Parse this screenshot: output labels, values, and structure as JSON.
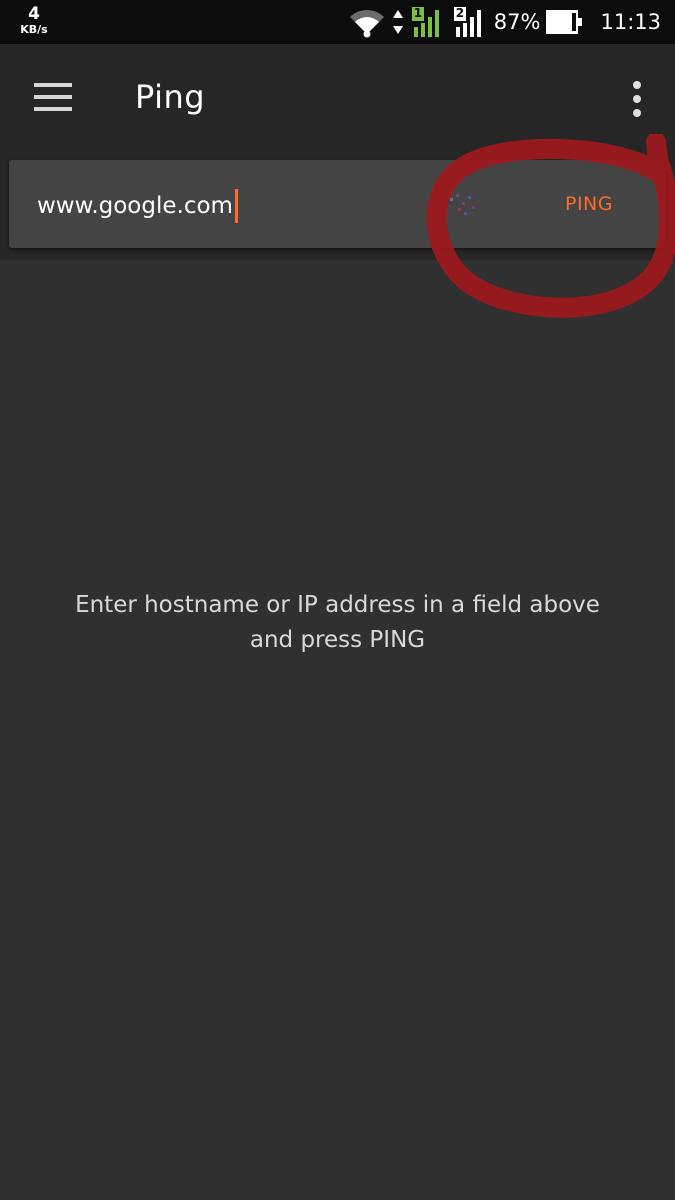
{
  "status_bar": {
    "net_speed_value": "4",
    "net_speed_unit": "KB/s",
    "sim1_label": "1",
    "sim2_label": "2",
    "battery_percent": "87%",
    "clock": "11:13",
    "icons": [
      "wifi-icon",
      "data-arrows-icon",
      "signal-sim1-icon",
      "signal-sim2-icon",
      "battery-icon"
    ]
  },
  "app_bar": {
    "title": "Ping",
    "icons": [
      "menu-icon",
      "overflow-menu-icon"
    ]
  },
  "ping_form": {
    "host_value": "www.google.com",
    "button_label": "PING"
  },
  "empty_state": {
    "line1": "Enter hostname or IP address in a field above",
    "line2": "and press PING"
  },
  "colors": {
    "accent": "#ff6a2b",
    "background": "#303030",
    "app_bar": "#262626",
    "card": "#444444",
    "annotation_circle": "#a0191c",
    "sim1_green": "#7ac143"
  }
}
